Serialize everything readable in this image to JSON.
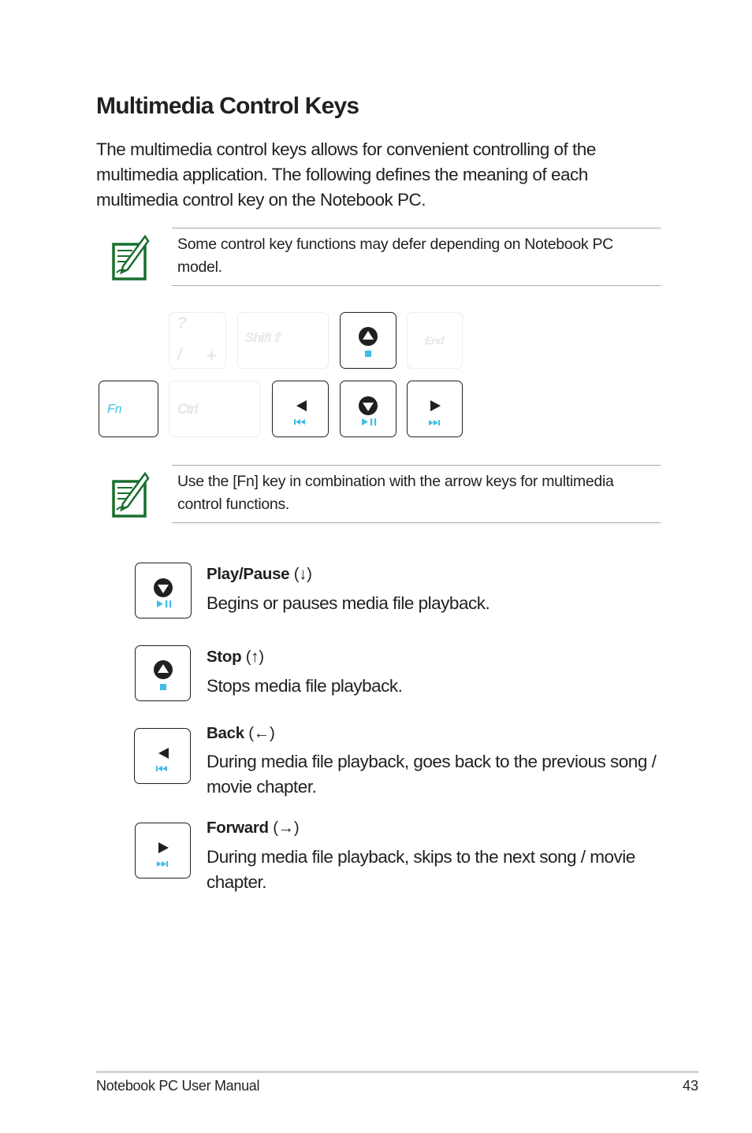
{
  "page": {
    "title": "Multimedia Control Keys",
    "intro": "The multimedia control keys allows for convenient controlling of the multimedia application. The following defines the meaning of each multimedia control key on the Notebook PC.",
    "notes": [
      {
        "icon": "note-pen-icon",
        "text": "Some control key functions may defer depending on Notebook PC model."
      },
      {
        "icon": "note-pen-icon",
        "text": "Use the [Fn] key in combination with the arrow keys for multimedia control functions."
      }
    ],
    "keyboard": {
      "keys": [
        {
          "id": "slash",
          "top": "?",
          "bottom_left": "/",
          "bottom_right": "+",
          "state": "faded"
        },
        {
          "id": "shift",
          "label": "Shift⇧",
          "state": "faded"
        },
        {
          "id": "up",
          "arrow": "up",
          "media": "stop",
          "state": "active"
        },
        {
          "id": "end",
          "label": "End",
          "state": "faded"
        },
        {
          "id": "fn",
          "label": "Fn",
          "state": "active"
        },
        {
          "id": "ctrl",
          "label": "Ctrl",
          "state": "faded"
        },
        {
          "id": "left",
          "arrow": "left",
          "media": "previous",
          "state": "active"
        },
        {
          "id": "down",
          "arrow": "down",
          "media": "play-pause",
          "state": "active"
        },
        {
          "id": "right",
          "arrow": "right",
          "media": "next",
          "state": "active"
        }
      ]
    },
    "items": [
      {
        "name": "Play/Pause",
        "arrow": "(↓)",
        "desc": "Begins or pauses media file playback."
      },
      {
        "name": "Stop",
        "arrow": "(↑)",
        "desc": "Stops media file playback."
      },
      {
        "name": "Back",
        "arrow": "(←)",
        "desc": "During media file playback, goes back to the previous song / movie chapter."
      },
      {
        "name": "Forward",
        "arrow": "(→)",
        "desc": "During media file playback, skips to the next song / movie chapter."
      }
    ],
    "footer": {
      "manual": "Notebook PC User Manual",
      "page_number": "43"
    },
    "colors": {
      "accent_cyan": "#3fbde6",
      "note_green": "#1a6e2e",
      "text": "#231f20",
      "rule": "#a7a9ac"
    }
  }
}
